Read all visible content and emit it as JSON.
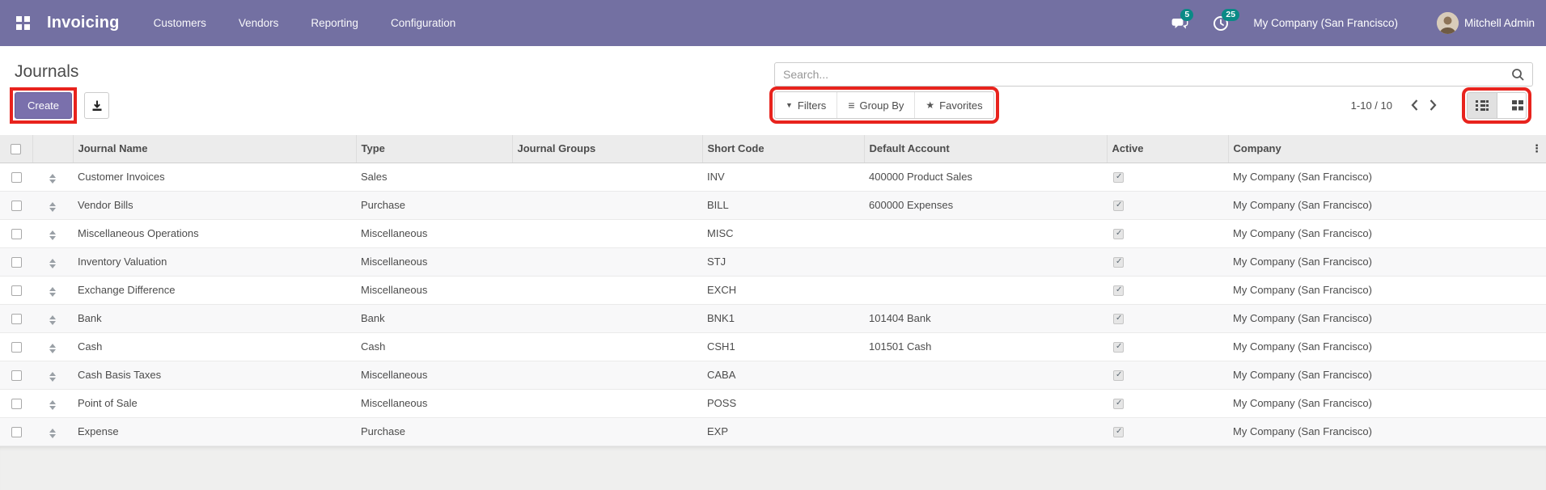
{
  "colors": {
    "nav_bg": "#7370a2",
    "primary_button": "#7a70ac",
    "badge": "#0a8a86",
    "annotation_red": "#e8231d"
  },
  "icons": {
    "filter": "▼",
    "group_by": "≡",
    "favorites": "★",
    "kebab": "⋮"
  },
  "nav": {
    "app_name": "Invoicing",
    "menus": [
      "Customers",
      "Vendors",
      "Reporting",
      "Configuration"
    ],
    "messages_badge": "5",
    "activities_badge": "25",
    "company": "My Company (San Francisco)",
    "user": "Mitchell Admin"
  },
  "control_panel": {
    "title": "Journals",
    "create_label": "Create",
    "search_placeholder": "Search...",
    "filters_label": "Filters",
    "group_by_label": "Group By",
    "favorites_label": "Favorites",
    "pager": "1-10 / 10"
  },
  "table": {
    "headers": [
      "Journal Name",
      "Type",
      "Journal Groups",
      "Short Code",
      "Default Account",
      "Active",
      "Company"
    ],
    "rows": [
      {
        "name": "Customer Invoices",
        "type": "Sales",
        "groups": "",
        "short_code": "INV",
        "default_account": "400000 Product Sales",
        "active": true,
        "company": "My Company (San Francisco)"
      },
      {
        "name": "Vendor Bills",
        "type": "Purchase",
        "groups": "",
        "short_code": "BILL",
        "default_account": "600000 Expenses",
        "active": true,
        "company": "My Company (San Francisco)"
      },
      {
        "name": "Miscellaneous Operations",
        "type": "Miscellaneous",
        "groups": "",
        "short_code": "MISC",
        "default_account": "",
        "active": true,
        "company": "My Company (San Francisco)"
      },
      {
        "name": "Inventory Valuation",
        "type": "Miscellaneous",
        "groups": "",
        "short_code": "STJ",
        "default_account": "",
        "active": true,
        "company": "My Company (San Francisco)"
      },
      {
        "name": "Exchange Difference",
        "type": "Miscellaneous",
        "groups": "",
        "short_code": "EXCH",
        "default_account": "",
        "active": true,
        "company": "My Company (San Francisco)"
      },
      {
        "name": "Bank",
        "type": "Bank",
        "groups": "",
        "short_code": "BNK1",
        "default_account": "101404 Bank",
        "active": true,
        "company": "My Company (San Francisco)"
      },
      {
        "name": "Cash",
        "type": "Cash",
        "groups": "",
        "short_code": "CSH1",
        "default_account": "101501 Cash",
        "active": true,
        "company": "My Company (San Francisco)"
      },
      {
        "name": "Cash Basis Taxes",
        "type": "Miscellaneous",
        "groups": "",
        "short_code": "CABA",
        "default_account": "",
        "active": true,
        "company": "My Company (San Francisco)"
      },
      {
        "name": "Point of Sale",
        "type": "Miscellaneous",
        "groups": "",
        "short_code": "POSS",
        "default_account": "",
        "active": true,
        "company": "My Company (San Francisco)"
      },
      {
        "name": "Expense",
        "type": "Purchase",
        "groups": "",
        "short_code": "EXP",
        "default_account": "",
        "active": true,
        "company": "My Company (San Francisco)"
      }
    ]
  }
}
